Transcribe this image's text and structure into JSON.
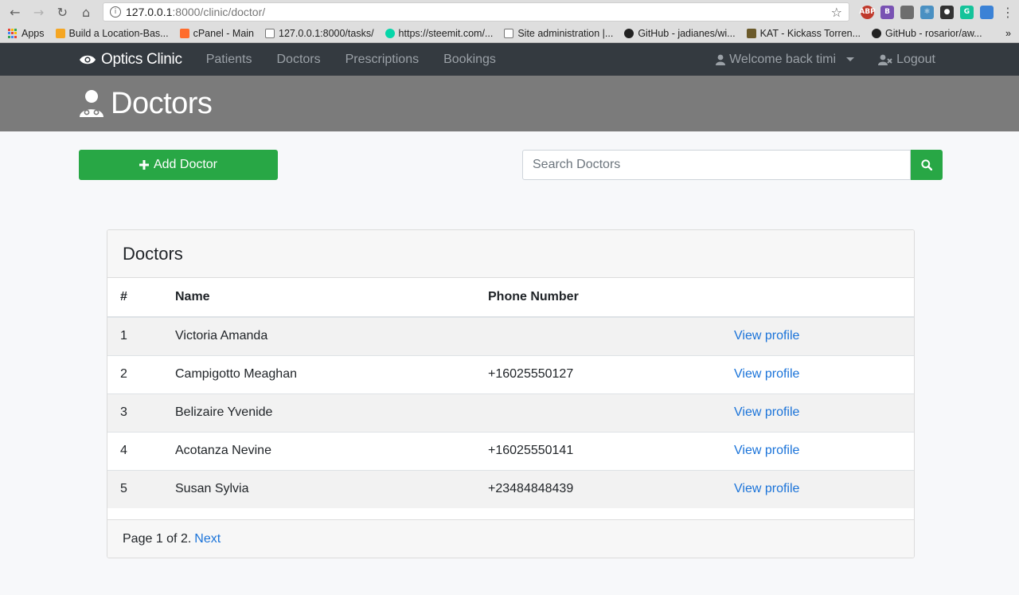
{
  "browser": {
    "url_host": "127.0.0.1",
    "url_path": ":8000/clinic/doctor/",
    "extensions": [
      {
        "label": "ABP",
        "color": "#c0392b"
      },
      {
        "label": "B",
        "color": "#7952b3"
      },
      {
        "label": "",
        "color": "#6d6d6d"
      },
      {
        "label": "⚛",
        "color": "#4a90c2"
      },
      {
        "label": "●",
        "color": "#333333"
      },
      {
        "label": "G",
        "color": "#15c39a"
      },
      {
        "label": "",
        "color": "#3b82d6"
      }
    ],
    "bookmarks": [
      "Apps",
      "Build a Location-Bas...",
      "cPanel - Main",
      "127.0.0.1:8000/tasks/",
      "https://steemit.com/...",
      "Site administration |...",
      "GitHub - jadianes/wi...",
      "KAT - Kickass Torren...",
      "GitHub - rosarior/aw..."
    ],
    "bookmark_more": "»"
  },
  "navbar": {
    "brand": "Optics Clinic",
    "links": [
      "Patients",
      "Doctors",
      "Prescriptions",
      "Bookings"
    ],
    "user": "Welcome back timi",
    "logout": "Logout"
  },
  "header": {
    "title": "Doctors"
  },
  "actions": {
    "add_label": "Add Doctor",
    "search_placeholder": "Search Doctors"
  },
  "card": {
    "title": "Doctors",
    "columns": [
      "#",
      "Name",
      "Phone Number",
      ""
    ],
    "rows": [
      {
        "num": "1",
        "name": "Victoria Amanda",
        "phone": "",
        "action": "View profile"
      },
      {
        "num": "2",
        "name": "Campigotto Meaghan",
        "phone": "+16025550127",
        "action": "View profile"
      },
      {
        "num": "3",
        "name": "Belizaire Yvenide",
        "phone": "",
        "action": "View profile"
      },
      {
        "num": "4",
        "name": "Acotanza Nevine",
        "phone": "+16025550141",
        "action": "View profile"
      },
      {
        "num": "5",
        "name": "Susan Sylvia",
        "phone": "+23484848439",
        "action": "View profile"
      }
    ],
    "pagination_text": "Page 1 of 2.",
    "next_label": "Next"
  }
}
